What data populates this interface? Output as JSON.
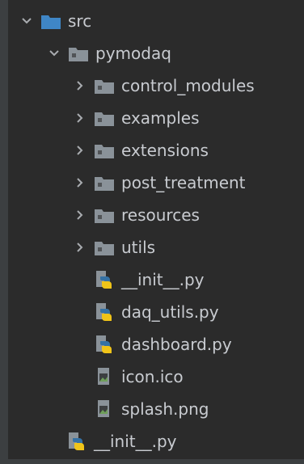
{
  "tree": {
    "src": {
      "label": "src",
      "icon": "folder-source-icon",
      "expanded": true
    },
    "pymodaq": {
      "label": "pymodaq",
      "icon": "folder-icon",
      "expanded": true
    },
    "children": [
      {
        "label": "control_modules",
        "icon": "folder-icon",
        "expandable": true
      },
      {
        "label": "examples",
        "icon": "folder-icon",
        "expandable": true
      },
      {
        "label": "extensions",
        "icon": "folder-icon",
        "expandable": true
      },
      {
        "label": "post_treatment",
        "icon": "folder-icon",
        "expandable": true
      },
      {
        "label": "resources",
        "icon": "folder-icon",
        "expandable": true
      },
      {
        "label": "utils",
        "icon": "folder-icon",
        "expandable": true
      },
      {
        "label": "__init__.py",
        "icon": "python-file-icon",
        "expandable": false
      },
      {
        "label": "daq_utils.py",
        "icon": "python-file-icon",
        "expandable": false
      },
      {
        "label": "dashboard.py",
        "icon": "python-file-icon",
        "expandable": false
      },
      {
        "label": "icon.ico",
        "icon": "image-file-icon",
        "expandable": false
      },
      {
        "label": "splash.png",
        "icon": "image-file-icon",
        "expandable": false
      }
    ],
    "src_init": {
      "label": "__init__.py",
      "icon": "python-file-icon"
    }
  },
  "colors": {
    "background": "#2b2b2b",
    "text": "#c8cbd0",
    "folder": "#8a9299",
    "source_folder": "#3f86c6",
    "python_blue": "#3572a5",
    "python_yellow": "#f0c419"
  }
}
